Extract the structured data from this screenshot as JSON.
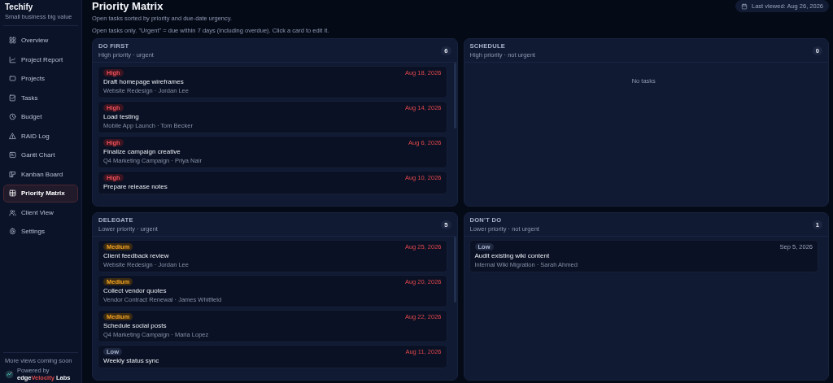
{
  "sidebar": {
    "app_name": "Techify",
    "tagline": "Small business big value",
    "items": [
      {
        "label": "Overview",
        "selected": false
      },
      {
        "label": "Project Report",
        "selected": false
      },
      {
        "label": "Projects",
        "selected": false
      },
      {
        "label": "Tasks",
        "selected": false
      },
      {
        "label": "Budget",
        "selected": false
      },
      {
        "label": "RAID Log",
        "selected": false
      },
      {
        "label": "Gantt Chart",
        "selected": false
      },
      {
        "label": "Kanban Board",
        "selected": false
      },
      {
        "label": "Priority Matrix",
        "selected": true
      },
      {
        "label": "Client View",
        "selected": false
      },
      {
        "label": "Settings",
        "selected": false
      }
    ],
    "footer_note": "More views coming soon",
    "powered_by": "Powered by",
    "brand_parts": [
      {
        "text": "edge",
        "accent": false
      },
      {
        "text": "Velocity",
        "accent": true
      },
      {
        "text": " Labs",
        "accent": false
      }
    ]
  },
  "header": {
    "title": "Priority Matrix",
    "subtitle": "Open tasks sorted by priority and due-date urgency.",
    "last_viewed": "Last viewed: Aug 26, 2026"
  },
  "note": "Open tasks only. \"Urgent\" = due within 7 days (including overdue). Click a card to edit it.",
  "quadrants": [
    {
      "title": "DO FIRST",
      "subtitle": "High priority · urgent",
      "count": "6",
      "tasks": [
        {
          "priority": "High",
          "kind": "high",
          "due": "Aug 18, 2026",
          "urgent": true,
          "title": "Draft homepage wireframes",
          "meta": "Website Redesign · Jordan Lee"
        },
        {
          "priority": "High",
          "kind": "high",
          "due": "Aug 14, 2026",
          "urgent": true,
          "title": "Load testing",
          "meta": "Mobile App Launch · Tom Becker"
        },
        {
          "priority": "High",
          "kind": "high",
          "due": "Aug 6, 2026",
          "urgent": true,
          "title": "Finalize campaign creative",
          "meta": "Q4 Marketing Campaign · Priya Nair"
        },
        {
          "priority": "High",
          "kind": "high",
          "due": "Aug 10, 2026",
          "urgent": true,
          "title": "Prepare release notes"
        }
      ]
    },
    {
      "title": "SCHEDULE",
      "subtitle": "High priority · not urgent",
      "count": "0",
      "empty_text": "No tasks"
    },
    {
      "title": "DELEGATE",
      "subtitle": "Lower priority · urgent",
      "count": "5",
      "tasks": [
        {
          "priority": "Medium",
          "kind": "medium",
          "due": "Aug 25, 2026",
          "urgent": true,
          "title": "Client feedback review",
          "meta": "Website Redesign · Jordan Lee"
        },
        {
          "priority": "Medium",
          "kind": "medium",
          "due": "Aug 20, 2026",
          "urgent": true,
          "title": "Collect vendor quotes",
          "meta": "Vendor Contract Renewal · James Whitfield"
        },
        {
          "priority": "Medium",
          "kind": "medium",
          "due": "Aug 22, 2026",
          "urgent": true,
          "title": "Schedule social posts",
          "meta": "Q4 Marketing Campaign · Maria Lopez"
        },
        {
          "priority": "Low",
          "kind": "low",
          "due": "Aug 11, 2026",
          "urgent": true,
          "title": "Weekly status sync"
        }
      ]
    },
    {
      "title": "DON'T DO",
      "subtitle": "Lower priority · not urgent",
      "count": "1",
      "tasks": [
        {
          "priority": "Low",
          "kind": "low",
          "due": "Sep 5, 2026",
          "urgent": false,
          "title": "Audit existing wiki content",
          "meta": "Internal Wiki Migration · Sarah Ahmed"
        }
      ]
    }
  ]
}
